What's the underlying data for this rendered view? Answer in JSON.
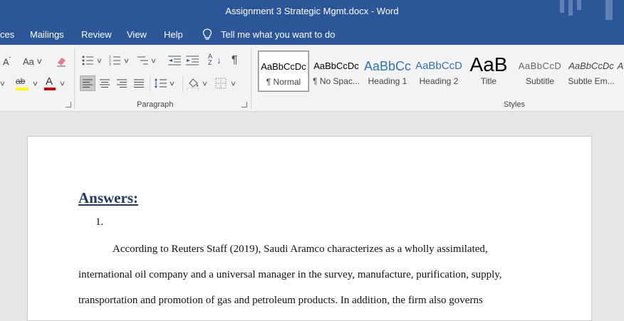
{
  "window": {
    "title": "Assignment 3 Strategic Mgmt.docx  -  Word",
    "accent": "#2b579a"
  },
  "menu": {
    "items": [
      "ces",
      "Mailings",
      "Review",
      "View",
      "Help"
    ],
    "tell_me": "Tell me what you want to do",
    "tell_me_icon": "lightbulb-icon"
  },
  "ribbon": {
    "font_group": {
      "font_size_down": "A",
      "change_case": "Aa",
      "clear_format_icon": "eraser-icon",
      "highlight_label": "ab",
      "font_color_label": "A",
      "highlight_color": "#ffff00",
      "font_color": "#c00000"
    },
    "paragraph_group": {
      "label": "Paragraph",
      "icons": [
        "bullets-icon",
        "numbering-icon",
        "multilevel-list-icon",
        "decrease-indent-icon",
        "increase-indent-icon",
        "sort-icon",
        "pilcrow-icon",
        "align-left-icon",
        "center-icon",
        "align-right-icon",
        "justify-icon",
        "line-spacing-icon",
        "shading-icon",
        "borders-icon"
      ],
      "sort_label": "A Z",
      "pilcrow": "¶"
    },
    "styles_group": {
      "label": "Styles",
      "styles": [
        {
          "preview": "AaBbCcDc",
          "name": "¶ Normal"
        },
        {
          "preview": "AaBbCcDc",
          "name": "¶ No Spac..."
        },
        {
          "preview": "AaBbCc",
          "name": "Heading 1"
        },
        {
          "preview": "AaBbCcD",
          "name": "Heading 2"
        },
        {
          "preview": "AaB",
          "name": "Title"
        },
        {
          "preview": "AaBbCcD",
          "name": "Subtitle"
        },
        {
          "preview": "AaBbCcDc",
          "name": "Subtle Em..."
        },
        {
          "preview": "A",
          "name": ""
        }
      ]
    }
  },
  "document": {
    "heading": "Answers:",
    "list_number": "1.",
    "lines": [
      "According to Reuters Staff (2019), Saudi Aramco characterizes as a wholly assimilated,",
      "international oil company and a universal manager in the survey, manufacture, purification, supply,",
      "transportation and promotion of gas and petroleum products. In addition, the firm also governs"
    ]
  }
}
